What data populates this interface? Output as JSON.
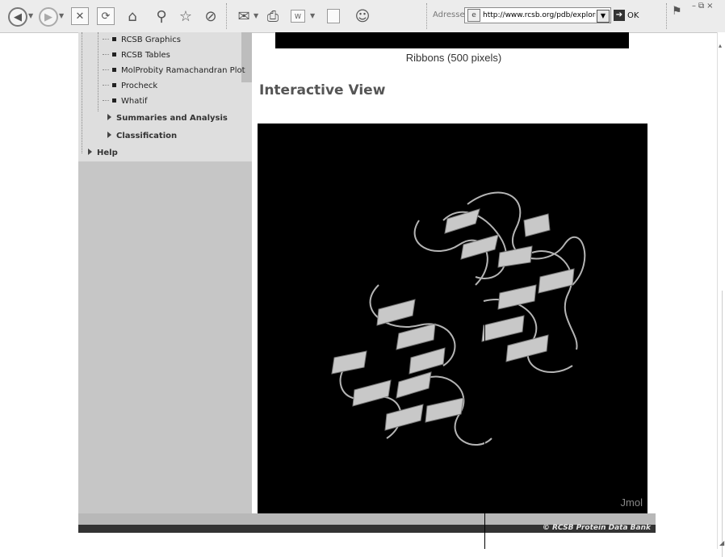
{
  "toolbar": {
    "back_icon": "back-arrow-icon",
    "forward_icon": "forward-arrow-icon",
    "address_label": "Adresse",
    "address_url": "http://www.rcsb.org/pdb/explore/imag",
    "go_label": "OK"
  },
  "sidebar": {
    "subitems": [
      {
        "label": "RCSB Graphics"
      },
      {
        "label": "RCSB Tables"
      },
      {
        "label": "MolProbity Ramachandran Plot"
      },
      {
        "label": "Procheck"
      },
      {
        "label": "Whatif"
      }
    ],
    "groups": [
      {
        "label": "Summaries and Analysis"
      },
      {
        "label": "Classification"
      },
      {
        "label": "Help"
      }
    ]
  },
  "main": {
    "image_caption": "Ribbons (500 pixels)",
    "section_heading": "Interactive View",
    "viewer_label": "Jmol"
  },
  "footer": {
    "copyright": "© RCSB Protein Data Bank"
  },
  "colors": {
    "viewer_background": "#000000",
    "sidebar_background": "#c6c6c6",
    "footer_dark": "#333333",
    "ribbon": "#bcbcbc"
  }
}
